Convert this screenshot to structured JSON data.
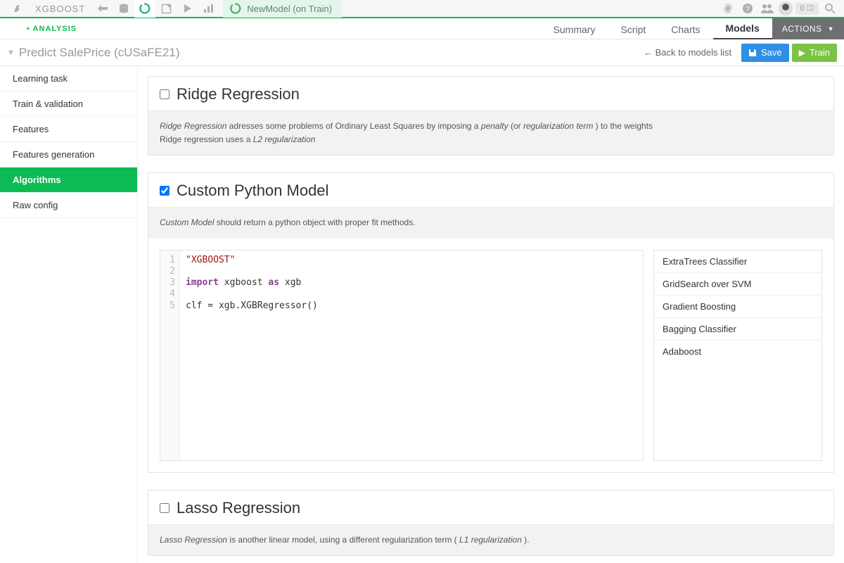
{
  "topnav": {
    "project": "XGBOOST",
    "recipe_label": "NewModel (on Train)",
    "badge": "0 ⎄"
  },
  "secondbar": {
    "analysis": "ANALYSIS",
    "tabs": [
      "Summary",
      "Script",
      "Charts",
      "Models"
    ],
    "active_tab": 3,
    "actions": "ACTIONS"
  },
  "thirdbar": {
    "title": "Predict SalePrice (cUSaFE21)",
    "back": "Back to models list",
    "save": "Save",
    "train": "Train"
  },
  "sidebar": {
    "items": [
      "Learning task",
      "Train & validation",
      "Features",
      "Features generation",
      "Algorithms",
      "Raw config"
    ],
    "active": 4
  },
  "algorithms": {
    "ridge": {
      "title": "Ridge Regression",
      "checked": false,
      "desc_html": "<em>Ridge Regression</em> adresses some problems of Ordinary Least Squares by imposing a <em>penalty</em> (or <em>regularization term</em> ) to the weights<br>Ridge regression uses a <em>L2 regularization</em>"
    },
    "custom": {
      "title": "Custom Python Model",
      "checked": true,
      "desc_html": "<em>Custom Model</em> should return a python object with proper fit methods.",
      "code_lines": [
        {
          "n": 1,
          "html": "<span class='str'>\"XGBOOST\"</span>"
        },
        {
          "n": 2,
          "html": ""
        },
        {
          "n": 3,
          "html": "<span class='kw'>import</span> xgboost <span class='kw'>as</span> xgb"
        },
        {
          "n": 4,
          "html": ""
        },
        {
          "n": 5,
          "html": "clf = xgb.XGBRegressor()"
        }
      ],
      "presets": [
        "ExtraTrees Classifier",
        "GridSearch over SVM",
        "Gradient Boosting",
        "Bagging Classifier",
        "Adaboost"
      ]
    },
    "lasso": {
      "title": "Lasso Regression",
      "checked": false,
      "desc_html": "<em>Lasso Regression</em> is another linear model, using a different regularization term ( <em>L1 regularization</em> )."
    }
  }
}
